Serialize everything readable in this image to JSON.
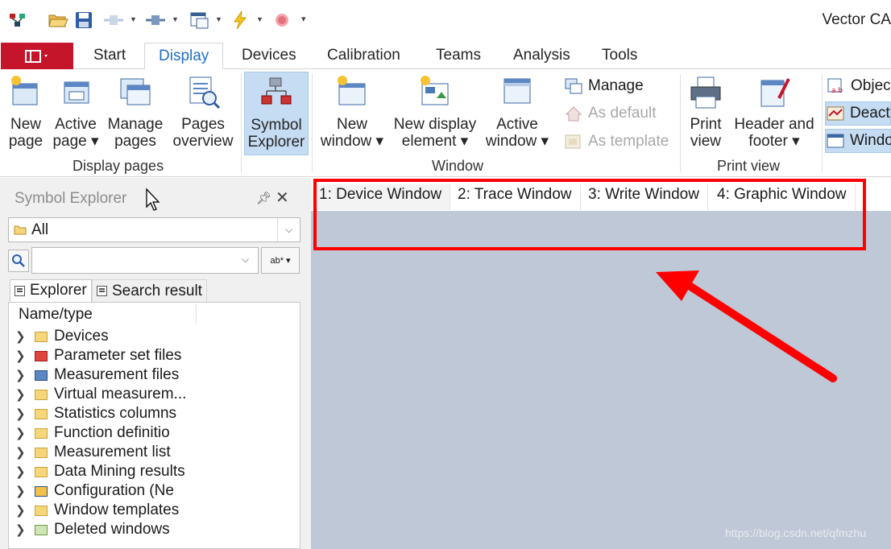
{
  "app": {
    "title": "Vector CA"
  },
  "ribbon_tabs": [
    "Start",
    "Display",
    "Devices",
    "Calibration",
    "Teams",
    "Analysis",
    "Tools"
  ],
  "ribbon_tab_active": "Display",
  "ribbon": {
    "display_pages": {
      "label": "Display pages",
      "buttons": [
        {
          "l1": "New",
          "l2": "page"
        },
        {
          "l1": "Active",
          "l2": "page ▾"
        },
        {
          "l1": "Manage",
          "l2": "pages"
        },
        {
          "l1": "Pages",
          "l2": "overview"
        }
      ]
    },
    "symbol_explorer": {
      "l1": "Symbol",
      "l2": "Explorer"
    },
    "window": {
      "label": "Window",
      "buttons": [
        {
          "l1": "New",
          "l2": "window ▾"
        },
        {
          "l1": "New display",
          "l2": "element ▾"
        },
        {
          "l1": "Active",
          "l2": "window ▾"
        }
      ],
      "small": [
        "Manage",
        "As default",
        "As template"
      ]
    },
    "print_view": {
      "label": "Print view",
      "buttons": [
        {
          "l1": "Print",
          "l2": "view"
        },
        {
          "l1": "Header and",
          "l2": "footer ▾"
        }
      ]
    },
    "extra": [
      "Objec",
      "Deact",
      "Windo"
    ]
  },
  "symbol_explorer_panel": {
    "title": "Symbol Explorer",
    "filter_value": "All",
    "search_value": "",
    "regex_label": "ab* ▾",
    "tabs": [
      "Explorer",
      "Search result"
    ],
    "tree_header": "Name/type",
    "tree_items": [
      "Devices",
      "Parameter set files",
      "Measurement files",
      "Virtual measurem...",
      "Statistics columns",
      "Function definitio",
      "Measurement list",
      "Data Mining results",
      "Configuration (Ne",
      "Window templates",
      "Deleted windows"
    ]
  },
  "window_tabs": [
    "1: Device Window",
    "2: Trace Window",
    "3: Write Window",
    "4: Graphic Window"
  ],
  "active_window_tab": "1: Device Window",
  "watermark": "https://blog.csdn.net/qfmzhu",
  "colors": {
    "accent": "#1f6fc5",
    "file_button": "#c4152b",
    "mdi_background": "#bec8d6",
    "highlight": "#ff0000"
  }
}
